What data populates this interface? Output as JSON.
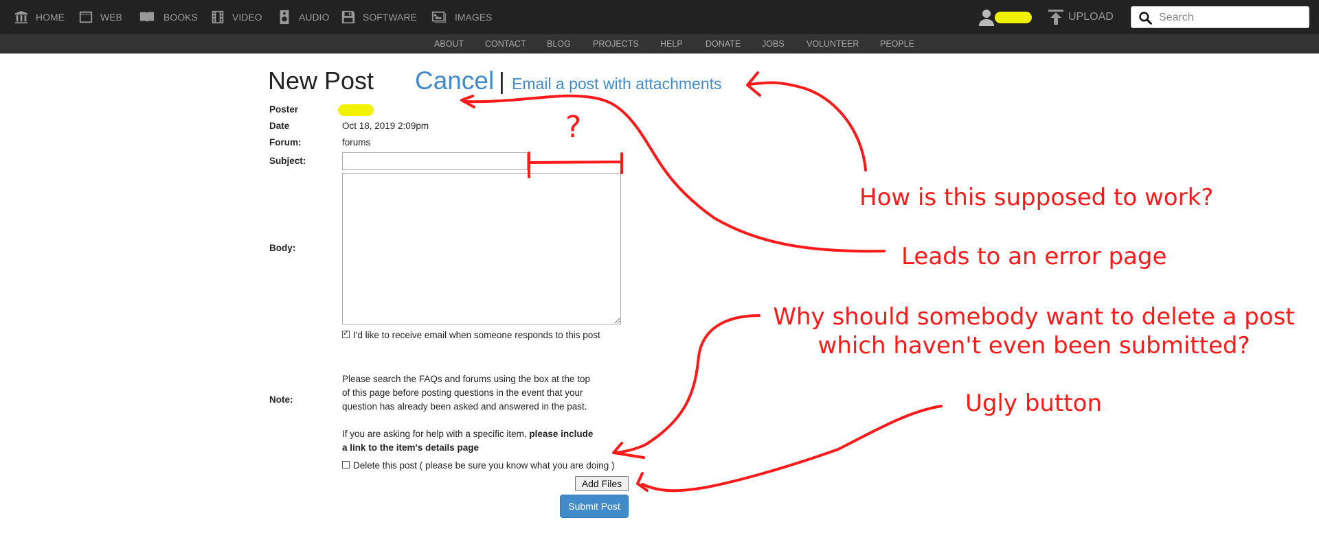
{
  "topnav": {
    "items": [
      {
        "label": "HOME",
        "icon": "library-icon"
      },
      {
        "label": "WEB",
        "icon": "web-icon"
      },
      {
        "label": "BOOKS",
        "icon": "book-icon"
      },
      {
        "label": "VIDEO",
        "icon": "film-icon"
      },
      {
        "label": "AUDIO",
        "icon": "speaker-icon"
      },
      {
        "label": "SOFTWARE",
        "icon": "floppy-icon"
      },
      {
        "label": "IMAGES",
        "icon": "image-icon"
      }
    ],
    "upload_label": "UPLOAD",
    "search_placeholder": "Search"
  },
  "subnav": [
    "ABOUT",
    "CONTACT",
    "BLOG",
    "PROJECTS",
    "HELP",
    "DONATE",
    "JOBS",
    "VOLUNTEER",
    "PEOPLE"
  ],
  "form": {
    "title": "New Post",
    "cancel_label": "Cancel",
    "separator": "|",
    "email_link": "Email a post with attachments",
    "poster_label": "Poster",
    "date_label": "Date",
    "date_value": "Oct 18, 2019 2:09pm",
    "forum_label": "Forum:",
    "forum_value": "forums",
    "subject_label": "Subject:",
    "body_label": "Body:",
    "email_checkbox_label": "I'd like to receive email when someone responds to this post",
    "email_checked": true,
    "note_label": "Note:",
    "note_lines": [
      "Please search the FAQs and forums using the box at the top",
      "of this page before posting questions in the event that your",
      "question has already been asked and answered in the past."
    ],
    "note_item_prefix": "If you are asking for help with a specific item,",
    "note_item_bold_1": "please include",
    "note_item_bold_2": "a link to the item's details page",
    "delete_label": "Delete this post ( please be sure you know what you are doing )",
    "delete_checked": false,
    "add_files_label": "Add Files",
    "submit_label": "Submit Post"
  },
  "annotations": {
    "question_mark": "?",
    "how_work": "How is this supposed to work?",
    "error_page": "Leads to an error page",
    "delete_q_1": "Why should somebody want to delete a post",
    "delete_q_2": "which haven't even been submitted?",
    "ugly": "Ugly button",
    "color": "#ff1a1a",
    "highlight_color": "#f2f200"
  }
}
